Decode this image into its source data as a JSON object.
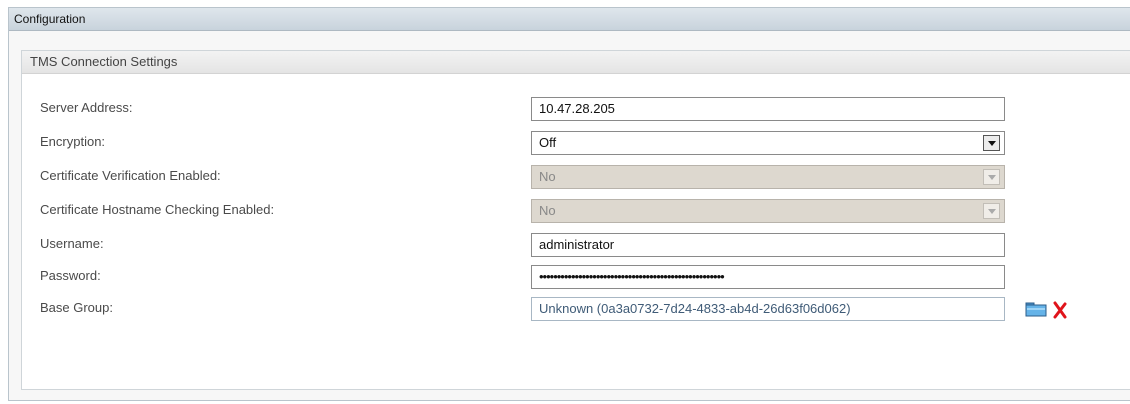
{
  "panel": {
    "title": "Configuration"
  },
  "section": {
    "title": "TMS Connection Settings"
  },
  "fields": {
    "server_address": {
      "label": "Server Address:",
      "value": "10.47.28.205"
    },
    "encryption": {
      "label": "Encryption:",
      "value": "Off"
    },
    "cert_verification": {
      "label": "Certificate Verification Enabled:",
      "value": "No"
    },
    "cert_hostname": {
      "label": "Certificate Hostname Checking Enabled:",
      "value": "No"
    },
    "username": {
      "label": "Username:",
      "value": "administrator"
    },
    "password": {
      "label": "Password:",
      "value": "••••••••••••••••••••••••••••••••••••••••••••••••••••"
    },
    "base_group": {
      "label": "Base Group:",
      "value": "Unknown (0a3a0732-7d24-4833-ab4d-26d63f06d062)"
    }
  },
  "icons": {
    "browse": "folder-icon",
    "remove": "delete-icon"
  },
  "colors": {
    "header_bg": "#dfe6ec",
    "disabled_bg": "#ddd8cf",
    "delete_red": "#e0141b"
  }
}
